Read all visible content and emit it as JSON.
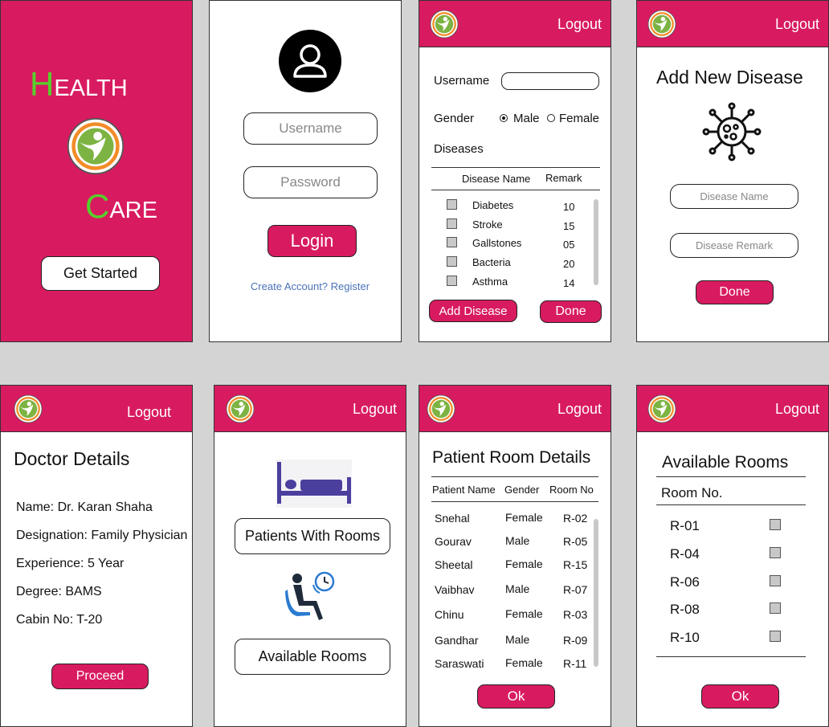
{
  "brand": {
    "health_initial": "H",
    "health_rest": "EALTH",
    "care_initial": "C",
    "care_rest": "ARE"
  },
  "common": {
    "logout": "Logout"
  },
  "splash": {
    "get_started": "Get Started"
  },
  "login": {
    "username_placeholder": "Username",
    "password_placeholder": "Password",
    "login_button": "Login",
    "register_link": "Create Account? Register"
  },
  "patient_form": {
    "username_label": "Username",
    "gender_label": "Gender",
    "male": "Male",
    "female": "Female",
    "selected_gender": "Male",
    "diseases_label": "Diseases",
    "col_name": "Disease Name",
    "col_remark": "Remark",
    "rows": [
      {
        "name": "Diabetes",
        "remark": "10"
      },
      {
        "name": "Stroke",
        "remark": "15"
      },
      {
        "name": "Gallstones",
        "remark": "05"
      },
      {
        "name": "Bacteria",
        "remark": "20"
      },
      {
        "name": "Asthma",
        "remark": "14"
      }
    ],
    "add_disease": "Add Disease",
    "done": "Done"
  },
  "add_disease": {
    "title": "Add New Disease",
    "name_placeholder": "Disease Name",
    "remark_placeholder": "Disease Remark",
    "done": "Done",
    "icon": "virus-icon"
  },
  "doctor": {
    "title": "Doctor Details",
    "lines": [
      "Name: Dr. Karan Shaha",
      "Designation: Family Physician",
      "Experience: 5 Year",
      "Degree: BAMS",
      "Cabin No: T-20"
    ],
    "proceed": "Proceed"
  },
  "menu": {
    "patients_with_rooms": "Patients With Rooms",
    "available_rooms": "Available Rooms",
    "bed_icon": "bed-icon",
    "waiting_icon": "waiting-icon"
  },
  "room_details": {
    "title": "Patient Room Details",
    "col_name": "Patient Name",
    "col_gender": "Gender",
    "col_room": "Room No",
    "rows": [
      {
        "name": "Snehal",
        "gender": "Female",
        "room": "R-02"
      },
      {
        "name": "Gourav",
        "gender": "Male",
        "room": "R-05"
      },
      {
        "name": "Sheetal",
        "gender": "Female",
        "room": "R-15"
      },
      {
        "name": "Vaibhav",
        "gender": "Male",
        "room": "R-07"
      },
      {
        "name": "Chinu",
        "gender": "Female",
        "room": "R-03"
      },
      {
        "name": "Gandhar",
        "gender": "Male",
        "room": "R-09"
      },
      {
        "name": "Saraswati",
        "gender": "Female",
        "room": "R-11"
      }
    ],
    "ok": "Ok"
  },
  "available": {
    "title": "Available Rooms",
    "col_room": "Room No.",
    "rooms": [
      "R-01",
      "R-04",
      "R-06",
      "R-08",
      "R-10"
    ],
    "ok": "Ok"
  },
  "colors": {
    "primary": "#d81b60",
    "accent_green": "#55d12b",
    "logo_green": "#7cb342",
    "logo_orange": "#f28c28",
    "bed": "#4b3f9e",
    "chair": "#2b7bd1"
  }
}
